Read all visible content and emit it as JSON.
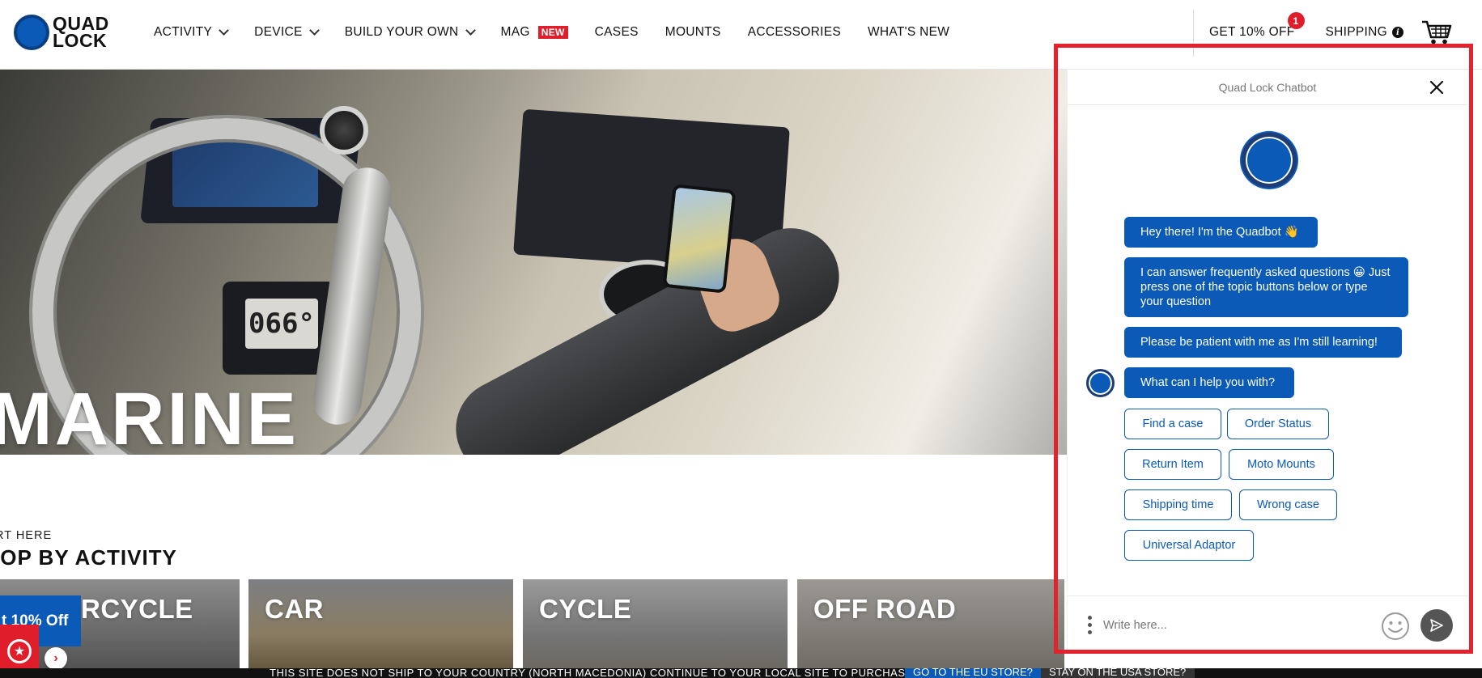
{
  "header": {
    "logo": {
      "line1": "QUAD",
      "line2": "LOCK",
      "reg": "®"
    },
    "nav": [
      {
        "label": "ACTIVITY",
        "has_dropdown": true
      },
      {
        "label": "DEVICE",
        "has_dropdown": true
      },
      {
        "label": "BUILD YOUR OWN",
        "has_dropdown": true
      },
      {
        "label": "MAG",
        "badge": "NEW"
      },
      {
        "label": "CASES"
      },
      {
        "label": "MOUNTS"
      },
      {
        "label": "ACCESSORIES"
      },
      {
        "label": "WHAT'S NEW"
      }
    ],
    "promo": {
      "label": "GET 10% OFF",
      "count": "1"
    },
    "shipping": {
      "label": "SHIPPING",
      "icon": "info-icon"
    },
    "cart_icon": "cart-icon"
  },
  "hero": {
    "title": "MARINE",
    "gauge_readout": "066°"
  },
  "shop": {
    "eyebrow": "RT HERE",
    "title": "IOP BY ACTIVITY",
    "tiles": [
      {
        "label": "RCYCLE"
      },
      {
        "label": "CAR"
      },
      {
        "label": "CYCLE"
      },
      {
        "label": "OFF ROAD"
      }
    ]
  },
  "promo_tab": {
    "label": "t 10% Off"
  },
  "geo_bar": {
    "message": "THIS SITE DOES NOT SHIP TO YOUR COUNTRY (NORTH MACEDONIA) CONTINUE TO YOUR LOCAL SITE TO PURCHASE?",
    "eu_button": "GO TO THE EU STORE?",
    "usa_button": "STAY ON THE USA STORE?"
  },
  "chatbot": {
    "title": "Quad Lock Chatbot",
    "messages": [
      "Hey there! I'm the Quadbot 👋",
      "I can answer frequently asked questions 😀 Just press one of the topic buttons below or type your question",
      "Please be patient with me as I'm still learning!",
      "What can I help you with?"
    ],
    "quick_replies": [
      "Find a case",
      "Order Status",
      "Return Item",
      "Moto Mounts",
      "Shipping time",
      "Wrong case",
      "Universal Adaptor"
    ],
    "input_placeholder": "Write here..."
  },
  "colors": {
    "brand_blue": "#0b5ab7",
    "accent_red": "#e01e2b",
    "highlight_red": "#e4222e"
  }
}
